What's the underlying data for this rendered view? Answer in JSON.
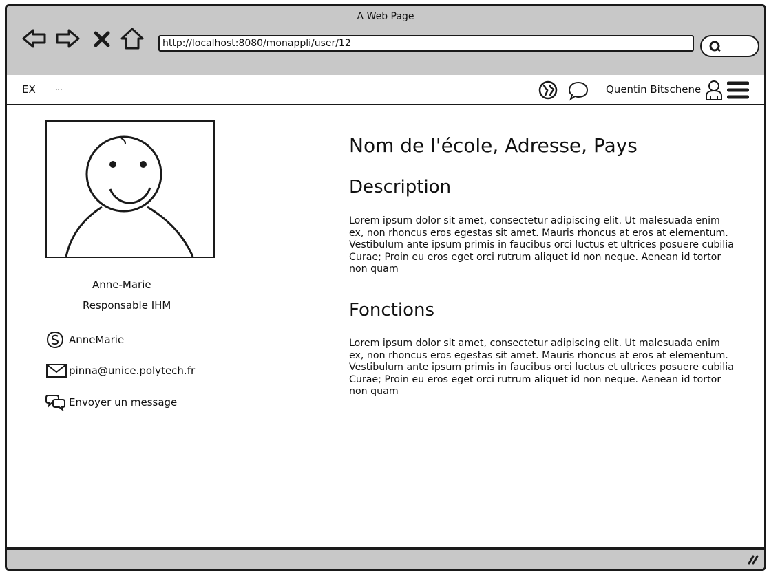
{
  "window": {
    "title": "A Web Page",
    "url": "http://localhost:8080/monappli/user/12"
  },
  "menubar": {
    "brand": "EX",
    "ellipsis": "...",
    "user_name": "Quentin Bitschene"
  },
  "profile": {
    "name": "Anne-Marie",
    "role": "Responsable IHM",
    "skype": "AnneMarie",
    "email": "pinna@unice.polytech.fr",
    "message_label": "Envoyer un message"
  },
  "content": {
    "heading": "Nom de l'école, Adresse, Pays",
    "description_title": "Description",
    "description_text": "Lorem ipsum dolor sit amet, consectetur adipiscing elit. Ut malesuada enim ex, non rhoncus eros egestas sit amet. Mauris rhoncus at eros at elementum. Vestibulum ante ipsum primis in faucibus orci luctus et ultrices posuere cubilia Curae; Proin eu eros eget orci rutrum aliquet id non neque. Aenean id tortor non quam",
    "functions_title": "Fonctions",
    "functions_text": "Lorem ipsum dolor sit amet, consectetur adipiscing elit. Ut malesuada enim ex, non rhoncus eros egestas sit amet. Mauris rhoncus at eros at elementum. Vestibulum ante ipsum primis in faucibus orci luctus et ultrices posuere cubilia Curae; Proin eu eros eget orci rutrum aliquet id non neque. Aenean id tortor non quam"
  },
  "icons": {
    "back": "arrow-left-icon",
    "forward": "arrow-right-icon",
    "stop": "close-icon",
    "home": "home-icon",
    "search": "search-icon",
    "globe": "globe-icon",
    "chat": "chat-bubble-icon",
    "user": "user-icon",
    "menu": "hamburger-menu-icon",
    "skype": "skype-icon",
    "mail": "envelope-icon",
    "message": "chat-bubbles-icon",
    "resize": "resize-grip-icon"
  }
}
